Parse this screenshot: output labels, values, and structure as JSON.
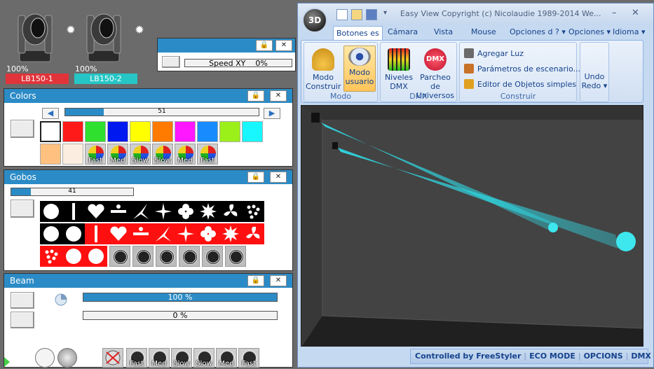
{
  "fixtures": [
    {
      "percent": "100%",
      "name": "LB150-1",
      "color": "#e0343a"
    },
    {
      "percent": "100%",
      "name": "LB150-2",
      "color": "#26c6c6"
    }
  ],
  "speed_panel": {
    "label": "Speed XY",
    "value": "0%"
  },
  "colors_panel": {
    "title": "Colors",
    "slider_value": "51",
    "slider_fraction": 0.2,
    "swatches": [
      "#ffffff",
      "#ff1a1a",
      "#2fe02f",
      "#0018f0",
      "#ffff00",
      "#ff7b00",
      "#ff18ff",
      "#188cff",
      "#9cf01a",
      "#18f7ff",
      "#ffc080",
      "#fbeee0"
    ],
    "wheel_labels": [
      "Fast",
      "Med",
      "Slow",
      "Slow",
      "Med",
      "Fast"
    ]
  },
  "gobos_panel": {
    "title": "Gobos",
    "slider_value": "41",
    "slider_fraction": 0.16,
    "rotation_icons": [
      "rotate-icon",
      "rotate-cw-icon",
      "rotate-ccw-icon",
      "rotate-cw-icon",
      "rotate-ccw-icon",
      "rotate-icon"
    ]
  },
  "beam_panel": {
    "title": "Beam",
    "bar1": "100 %",
    "bar1_fraction": 1.0,
    "bar2": "0 %",
    "bar2_fraction": 0.0,
    "strobe_labels": [
      "Fast",
      "Med",
      "Slow",
      "Slow",
      "Med",
      "Fast"
    ]
  },
  "app": {
    "title": "Easy View   Copyright (c) Nicolaudie 1989-2014   We...",
    "orb_label": "3D",
    "tabs": [
      "Botones es",
      "Cámara",
      "Vista",
      "Mouse",
      "Opciones d"
    ],
    "right_menu": [
      "?",
      "Opciones",
      "Idioma"
    ],
    "groups": {
      "modo": {
        "label": "Modo",
        "buttons": [
          {
            "line1": "Modo",
            "line2": "Construir"
          },
          {
            "line1": "Modo",
            "line2": "usuario"
          }
        ]
      },
      "dmx": {
        "label": "DMX",
        "buttons": [
          {
            "line1": "Niveles",
            "line2": "DMX"
          },
          {
            "line1": "Parcheo de",
            "line2": "Universos"
          }
        ]
      },
      "construir": {
        "label": "Construir",
        "items": [
          "Agregar Luz",
          "Parámetros de escenario...",
          "Editor de Objetos simples"
        ]
      },
      "undo": {
        "line1": "Undo",
        "line2": "Redo"
      }
    },
    "status": {
      "controlled": "Controlled by FreeStyler",
      "eco": "ECO MODE",
      "options": "OPCIONS",
      "dmx": "DMX ON"
    }
  }
}
